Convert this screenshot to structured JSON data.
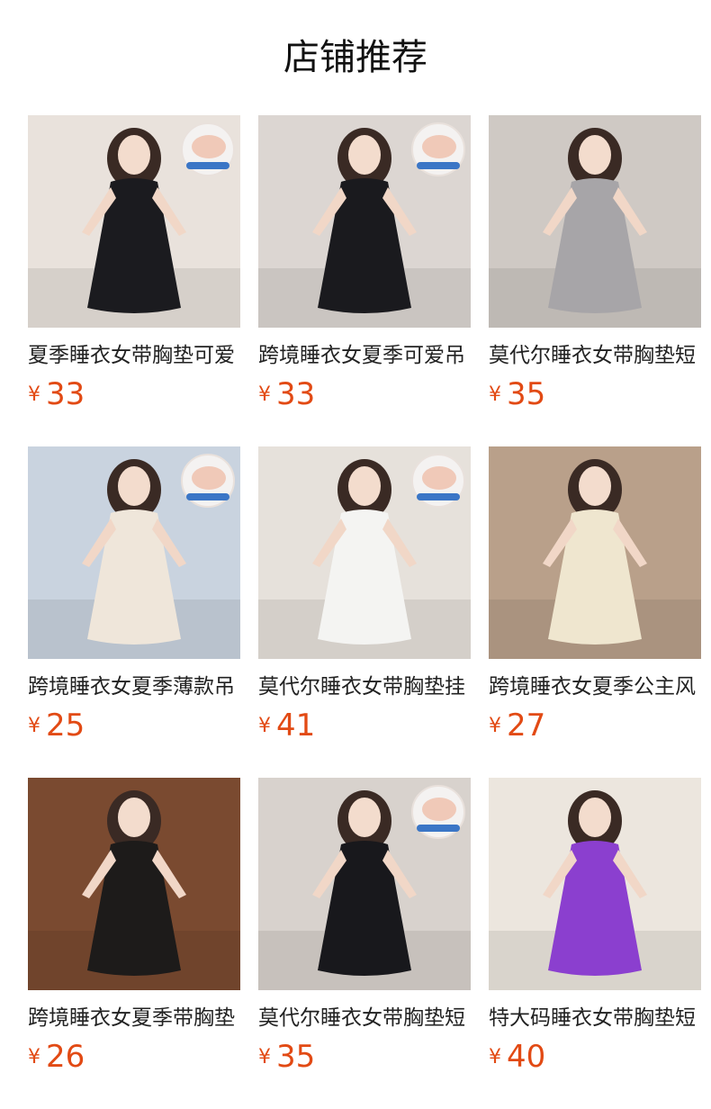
{
  "section": {
    "title": "店铺推荐"
  },
  "currency_symbol": "¥",
  "products": [
    {
      "title": "夏季睡衣女带胸垫可爱",
      "price": "33",
      "bg": "#e9e2dc",
      "figure": "#1b1b1f",
      "has_pad_badge": true
    },
    {
      "title": "跨境睡衣女夏季可爱吊",
      "price": "33",
      "bg": "#dcd6d2",
      "figure": "#1a1a1e",
      "has_pad_badge": true
    },
    {
      "title": "莫代尔睡衣女带胸垫短",
      "price": "35",
      "bg": "#cfc9c4",
      "figure": "#a7a5a8",
      "has_pad_badge": false
    },
    {
      "title": "跨境睡衣女夏季薄款吊",
      "price": "25",
      "bg": "#c9d3df",
      "figure": "#efe6da",
      "has_pad_badge": true
    },
    {
      "title": "莫代尔睡衣女带胸垫挂",
      "price": "41",
      "bg": "#e6e1db",
      "figure": "#f4f4f2",
      "has_pad_badge": true
    },
    {
      "title": "跨境睡衣女夏季公主风",
      "price": "27",
      "bg": "#b9a08a",
      "figure": "#efe6cf",
      "has_pad_badge": false
    },
    {
      "title": "跨境睡衣女夏季带胸垫",
      "price": "26",
      "bg": "#7a4a30",
      "figure": "#1d1b1a",
      "has_pad_badge": false
    },
    {
      "title": "莫代尔睡衣女带胸垫短",
      "price": "35",
      "bg": "#d8d2cd",
      "figure": "#18181c",
      "has_pad_badge": true
    },
    {
      "title": "特大码睡衣女带胸垫短",
      "price": "40",
      "bg": "#ece6de",
      "figure": "#8b3fcf",
      "has_pad_badge": false
    }
  ]
}
